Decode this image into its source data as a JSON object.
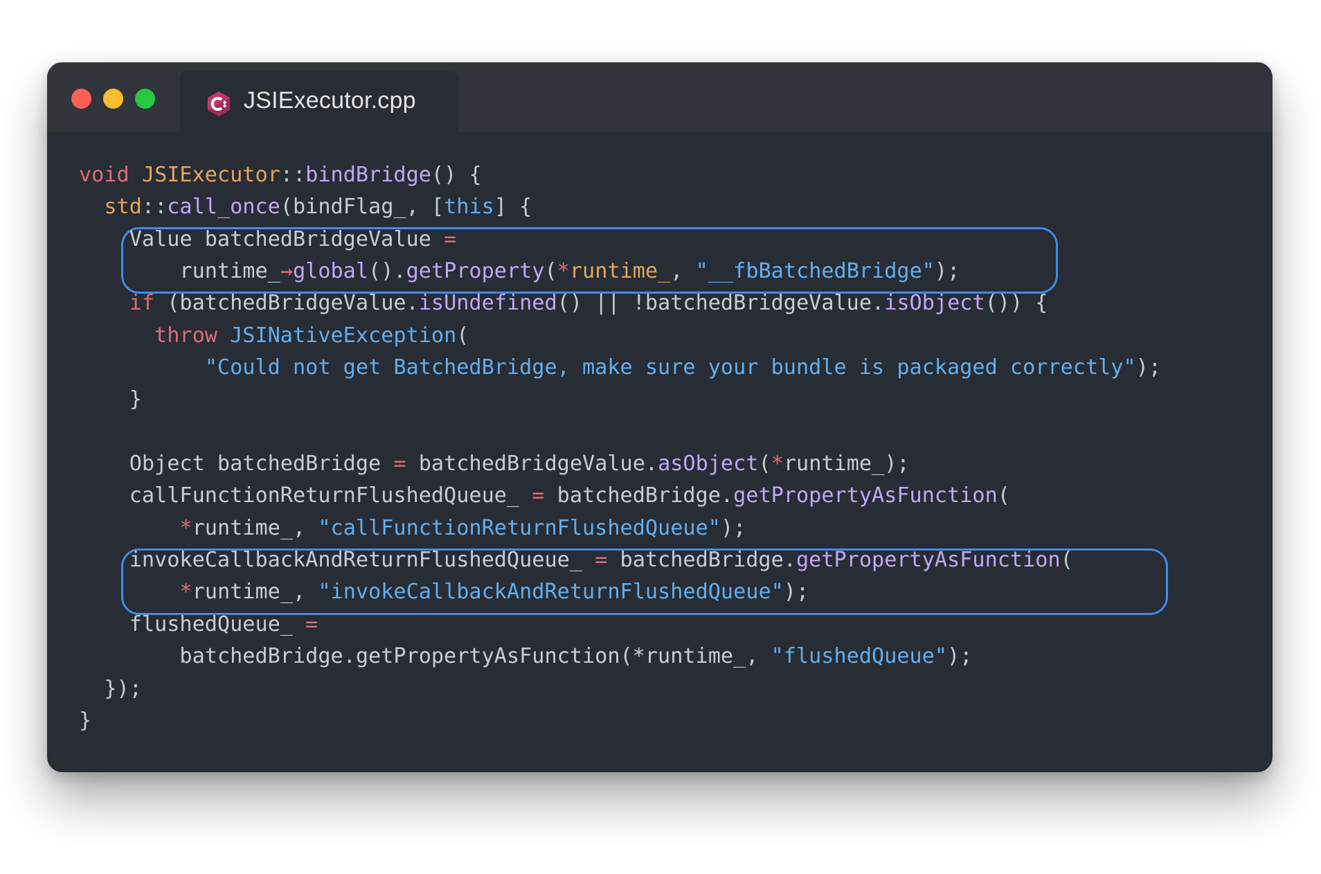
{
  "window": {
    "tab_title": "JSIExecutor.cpp",
    "tab_icon": "cpp-file-icon",
    "controls": [
      "close",
      "minimize",
      "maximize"
    ]
  },
  "code": {
    "language": "C++",
    "lines": [
      "void JSIExecutor::bindBridge() {",
      "  std::call_once(bindFlag_, [this] {",
      "    Value batchedBridgeValue =",
      "        runtime_->global().getProperty(*runtime_, \"__fbBatchedBridge\");",
      "    if (batchedBridgeValue.isUndefined() || !batchedBridgeValue.isObject()) {",
      "      throw JSINativeException(",
      "          \"Could not get BatchedBridge, make sure your bundle is packaged correctly\");",
      "    }",
      "",
      "    Object batchedBridge = batchedBridgeValue.asObject(*runtime_);",
      "    callFunctionReturnFlushedQueue_ = batchedBridge.getPropertyAsFunction(",
      "        *runtime_, \"callFunctionReturnFlushedQueue\");",
      "    invokeCallbackAndReturnFlushedQueue_ = batchedBridge.getPropertyAsFunction(",
      "        *runtime_, \"invokeCallbackAndReturnFlushedQueue\");",
      "    flushedQueue_ =",
      "        batchedBridge.getPropertyAsFunction(*runtime_, \"flushedQueue\");",
      "  });",
      "}"
    ],
    "highlighted_line_ranges": [
      [
        3,
        4
      ],
      [
        13,
        14
      ]
    ]
  },
  "colors": {
    "window_bg": "#282c34",
    "titlebar_bg": "#31343b",
    "highlight_border": "#3e8de8",
    "keyword": "#e06c75",
    "class": "#e5a55b",
    "function": "#c3a6f5",
    "string": "#61afef",
    "plain": "#c8ccd4"
  }
}
